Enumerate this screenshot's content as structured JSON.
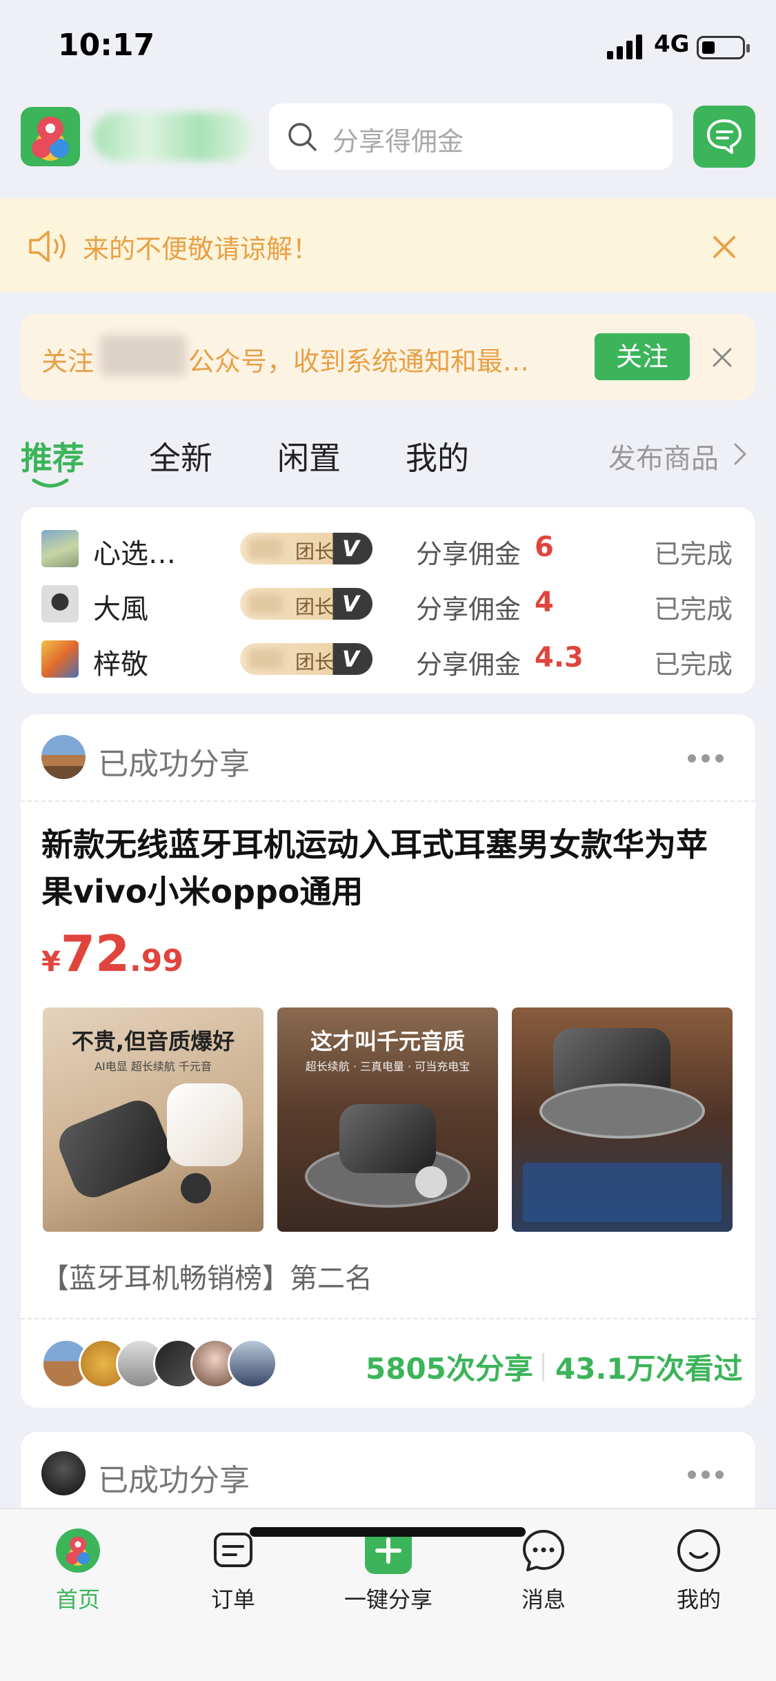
{
  "status_bar": {
    "time": "10:17",
    "network": "4G"
  },
  "header": {
    "search_placeholder": "分享得佣金"
  },
  "notice": {
    "text": "来的不便敬请谅解！"
  },
  "follow_banner": {
    "prefix": "关注",
    "text": "公众号，收到系统通知和最…",
    "button": "关注"
  },
  "tabs": [
    {
      "label": "推荐",
      "active": true
    },
    {
      "label": "全新",
      "active": false
    },
    {
      "label": "闲置",
      "active": false
    },
    {
      "label": "我的",
      "active": false
    }
  ],
  "publish_link": "发布商品",
  "commission_feed": [
    {
      "name": "心选…",
      "badge": "团长",
      "badge_mark": "V",
      "label": "分享佣金",
      "amount": "6",
      "status": "已完成"
    },
    {
      "name": "大風",
      "badge": "团长",
      "badge_mark": "V",
      "label": "分享佣金",
      "amount": "4",
      "status": "已完成"
    },
    {
      "name": "梓敬",
      "badge": "团长",
      "badge_mark": "V",
      "label": "分享佣金",
      "amount": "4.3",
      "status": "已完成"
    }
  ],
  "share_card": {
    "header": "已成功分享",
    "title": "新款无线蓝牙耳机运动入耳式耳塞男女款华为苹果vivo小米oppo通用",
    "price_currency": "¥",
    "price_int": "72",
    "price_dec": ".99",
    "images": [
      {
        "caption": "不贵,但音质爆好",
        "subcaption": "AI电显 超长续航 千元音"
      },
      {
        "caption": "这才叫千元音质",
        "subcaption": "超长续航 · 三真电量 · 可当充电宝"
      },
      {
        "caption": "",
        "subcaption": ""
      }
    ],
    "rank": "【蓝牙耳机畅销榜】第二名",
    "share_count": "5805次分享",
    "view_count": "43.1万次看过"
  },
  "share_card_2": {
    "header": "已成功分享"
  },
  "tab_bar": [
    {
      "label": "首页",
      "icon": "home-logo-icon",
      "active": true
    },
    {
      "label": "订单",
      "icon": "order-icon",
      "active": false
    },
    {
      "label": "一键分享",
      "icon": "plus-icon",
      "active": false
    },
    {
      "label": "消息",
      "icon": "message-icon",
      "active": false
    },
    {
      "label": "我的",
      "icon": "profile-icon",
      "active": false
    }
  ],
  "colors": {
    "brand": "#3cb45a",
    "price": "#e0443c",
    "notice": "#e8a045"
  }
}
